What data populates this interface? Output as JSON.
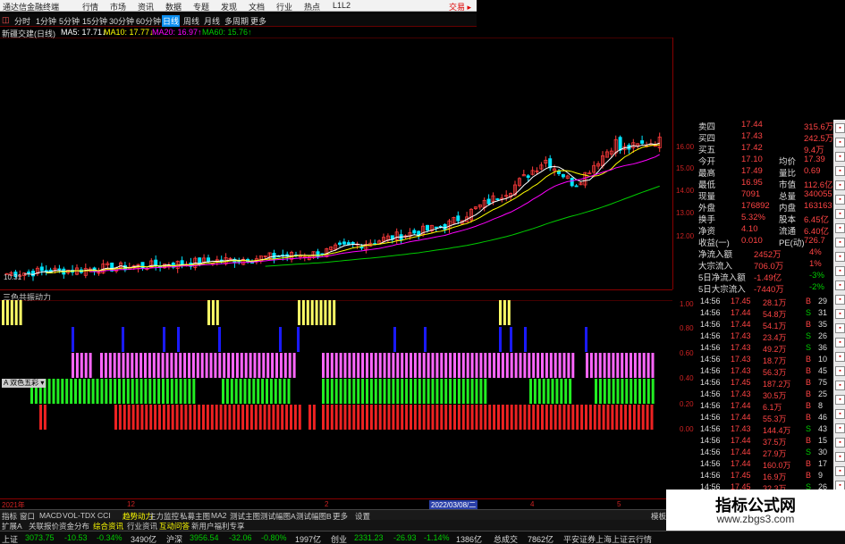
{
  "app": {
    "title": "通达信金融终端",
    "trade_button": "交易 ▸"
  },
  "menu": [
    "行情",
    "市场",
    "资讯",
    "数据",
    "专题",
    "发现",
    "文档",
    "行业",
    "热点",
    "L1L2"
  ],
  "period_tools": [
    "分时",
    "1分钟",
    "5分钟",
    "15分钟",
    "30分钟",
    "60分钟",
    "日线",
    "周线",
    "月线",
    "多周期",
    "更多"
  ],
  "period_active_index": 6,
  "ma_line": {
    "stock": "新疆交建(日线)",
    "ma5": "MA5: 17.71↓",
    "ma10": "MA10: 17.77↓",
    "ma20": "MA20: 16.97↑",
    "ma60": "MA60: 15.76↑"
  },
  "main_yaxis": [
    "16.00",
    "15.00",
    "14.00",
    "13.00",
    "12.00"
  ],
  "low_price_label": "10.31",
  "indicator": {
    "name": "三色共振动力",
    "yaxis": [
      "1.00",
      "0.80",
      "0.60",
      "0.40",
      "0.20",
      "0.00"
    ],
    "draw_label": "A 双色五彩 ▾"
  },
  "xaxis": {
    "labels": [
      "2021年",
      "12",
      "2",
      "2022/03/08/二",
      "4",
      "5"
    ]
  },
  "tabs": [
    "指标",
    "窗口",
    "MACD",
    "VOL-TDX",
    "CCI",
    "趋势动力",
    "主力监控",
    "私募主图",
    "MA2",
    "测试主图",
    "测试幅图A",
    "测试幅图B",
    "更多",
    "设置",
    "模板"
  ],
  "tab_selected": 5,
  "sub_tabs": [
    "扩展A",
    "关联报价",
    "资金分布",
    "综合资讯",
    "行业资讯",
    "互动问答",
    "新用户福利专享"
  ],
  "status": {
    "sh_label": "上证",
    "sh_val": "3073.75",
    "sh_chg": "-10.53",
    "sh_pct": "-0.34%",
    "sh_amt": "3490亿",
    "sz_label": "沪深",
    "sz_val": "3956.54",
    "sz_chg": "-32.06",
    "sz_pct": "-0.80%",
    "sz_amt": "1997亿",
    "cy_label": "创业",
    "cy_val": "2331.23",
    "cy_chg": "-26.93",
    "cy_pct": "-1.14%",
    "cy_amt": "1386亿",
    "total_label": "总成交",
    "total_amt": "7862亿",
    "broker": "平安证券上海上证云行情"
  },
  "quote_rows": [
    {
      "l": "卖四",
      "v": "17.44",
      "r": "315.6万"
    },
    {
      "l": "买四",
      "v": "17.43",
      "r": "242.5万"
    },
    {
      "l": "买五",
      "v": "17.42",
      "r": "9.4万"
    },
    {
      "l": "今开",
      "v": "17.10",
      "k": "均价",
      "r": "17.39"
    },
    {
      "l": "最高",
      "v": "17.49",
      "k": "量比",
      "r": "0.69"
    },
    {
      "l": "最低",
      "v": "16.95",
      "k": "市值",
      "r": "112.6亿"
    },
    {
      "l": "现量",
      "v": "7091",
      "k": "总量",
      "r": "340055"
    },
    {
      "l": "外盘",
      "v": "176892",
      "k": "内盘",
      "r": "163163"
    },
    {
      "l": "换手",
      "v": "5.32%",
      "k": "股本",
      "r": "6.45亿"
    },
    {
      "l": "净资",
      "v": "4.10",
      "k": "流通",
      "r": "6.40亿"
    },
    {
      "l": "收益(一)",
      "v": "0.010",
      "k": "PE(动)",
      "r": "726.7"
    },
    {
      "l": "净流入额",
      "v": "2452万",
      "r": "4%"
    },
    {
      "l": "大宗流入",
      "v": "706.0万",
      "r": "1%"
    },
    {
      "l": "5日净流入额",
      "v": "-1.49亿",
      "r": "-3%"
    },
    {
      "l": "5日大宗流入",
      "v": "-7440万",
      "r": "-2%"
    }
  ],
  "ticks": [
    {
      "t": "14:56",
      "p": "17.45",
      "v": "28.1万",
      "s": "B",
      "n": "29"
    },
    {
      "t": "14:56",
      "p": "17.44",
      "v": "54.8万",
      "s": "S",
      "n": "31"
    },
    {
      "t": "14:56",
      "p": "17.44",
      "v": "54.1万",
      "s": "B",
      "n": "35"
    },
    {
      "t": "14:56",
      "p": "17.43",
      "v": "23.4万",
      "s": "S",
      "n": "26"
    },
    {
      "t": "14:56",
      "p": "17.43",
      "v": "49.2万",
      "s": "S",
      "n": "36"
    },
    {
      "t": "14:56",
      "p": "17.43",
      "v": "18.7万",
      "s": "B",
      "n": "10"
    },
    {
      "t": "14:56",
      "p": "17.43",
      "v": "56.3万",
      "s": "B",
      "n": "45"
    },
    {
      "t": "14:56",
      "p": "17.45",
      "v": "187.2万",
      "s": "B",
      "n": "75"
    },
    {
      "t": "14:56",
      "p": "17.43",
      "v": "30.5万",
      "s": "B",
      "n": "25"
    },
    {
      "t": "14:56",
      "p": "17.44",
      "v": "6.1万",
      "s": "B",
      "n": "8"
    },
    {
      "t": "14:56",
      "p": "17.44",
      "v": "55.3万",
      "s": "B",
      "n": "46"
    },
    {
      "t": "14:56",
      "p": "17.43",
      "v": "144.4万",
      "s": "S",
      "n": "43"
    },
    {
      "t": "14:56",
      "p": "17.44",
      "v": "37.5万",
      "s": "B",
      "n": "15"
    },
    {
      "t": "14:56",
      "p": "17.44",
      "v": "27.9万",
      "s": "S",
      "n": "30"
    },
    {
      "t": "14:56",
      "p": "17.44",
      "v": "160.0万",
      "s": "B",
      "n": "17"
    },
    {
      "t": "14:56",
      "p": "17.45",
      "v": "16.9万",
      "s": "B",
      "n": "9"
    },
    {
      "t": "14:56",
      "p": "17.45",
      "v": "32.3万",
      "s": "S",
      "n": "26"
    }
  ],
  "watermark": {
    "title": "指标公式网",
    "url": "www.zbgs3.com"
  },
  "colors": {
    "up": "#ff3b3b",
    "down": "#00e5ff",
    "ma5": "#ffffff",
    "ma10": "#ffff00",
    "ma20": "#ff00ff",
    "ma60": "#00cc00",
    "yellow": "#ffff66",
    "blue": "#1a1aff",
    "magenta": "#ff66ff",
    "green": "#22ee22",
    "red": "#ee2222"
  }
}
